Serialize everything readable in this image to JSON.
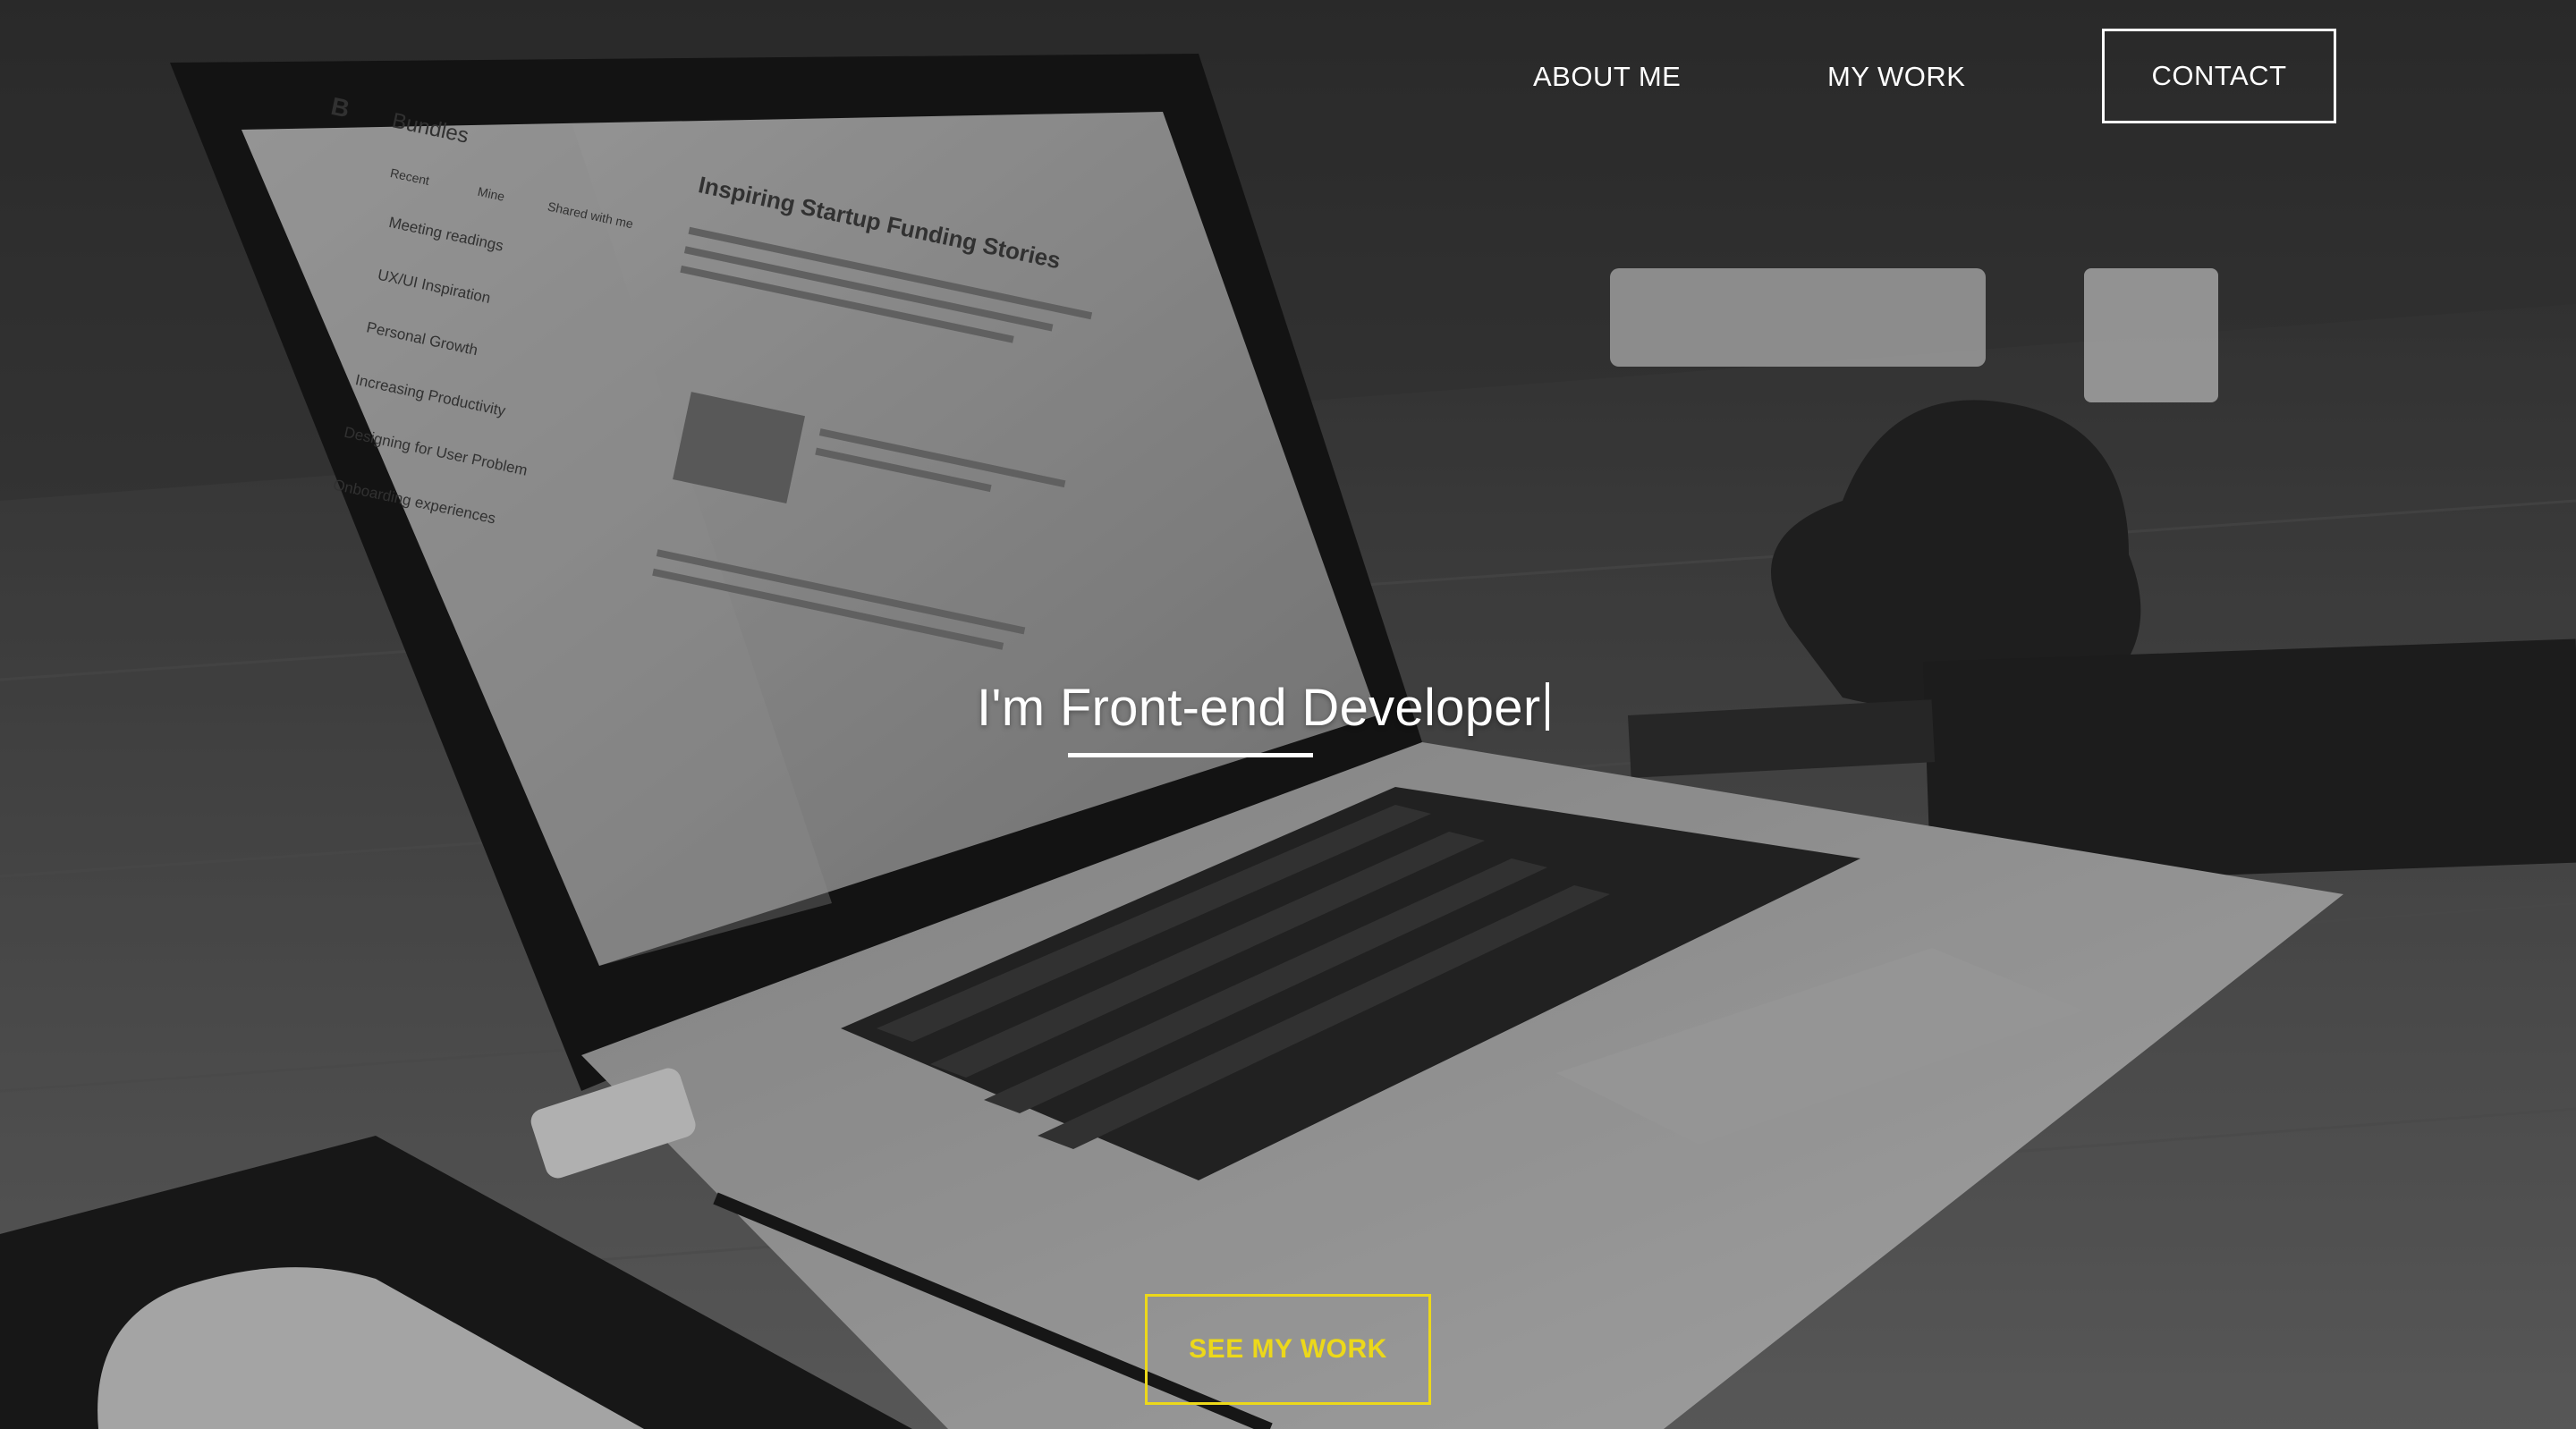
{
  "nav": {
    "about_label": "ABOUT ME",
    "work_label": "MY WORK",
    "contact_label": "CONTACT"
  },
  "hero": {
    "headline": "I'm Front-end Developer",
    "cta_label": "SEE MY WORK",
    "background_image": "laptop-on-desk-photo"
  },
  "laptop_screen": {
    "app_logo": "B",
    "app_name": "Bundles",
    "tabs": [
      "Recent",
      "Mine",
      "Shared with me"
    ],
    "items": [
      "Meeting readings",
      "UX/UI Inspiration",
      "Personal Growth",
      "Increasing Productivity",
      "Designing for User Problem",
      "Onboarding experiences"
    ],
    "article_title": "Inspiring Startup Funding Stories"
  },
  "colors": {
    "accent": "#ecd81a",
    "text": "#ffffff",
    "overlay": "#1e1e1e"
  }
}
